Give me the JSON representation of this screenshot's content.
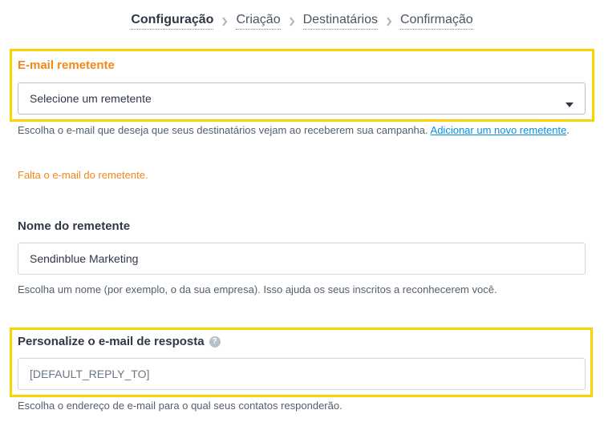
{
  "steps": [
    {
      "label": "Configuração"
    },
    {
      "label": "Criação"
    },
    {
      "label": "Destinatários"
    },
    {
      "label": "Confirmação"
    }
  ],
  "sender_email": {
    "label": "E-mail remetente",
    "select_value": "Selecione um remetente",
    "help_text": "Escolha o e-mail que deseja que seus destinatários vejam ao receberem sua campanha. ",
    "help_link": "Adicionar um novo remetente",
    "help_suffix": ".",
    "error": "Falta o e-mail do remetente."
  },
  "sender_name": {
    "label": "Nome do remetente",
    "value": "Sendinblue Marketing",
    "help_text": "Escolha um nome (por exemplo, o da sua empresa). Isso ajuda os seus inscritos a reconhecerem você."
  },
  "reply_to": {
    "label": "Personalize o e-mail de resposta",
    "help_icon": "question-circle-icon",
    "value": "[DEFAULT_REPLY_TO]",
    "help_text": "Escolha o endereço de e-mail para o qual seus contatos responderão."
  },
  "colors": {
    "highlight": "#fad300",
    "warning": "#f0891a",
    "link": "#0a8ee0"
  }
}
